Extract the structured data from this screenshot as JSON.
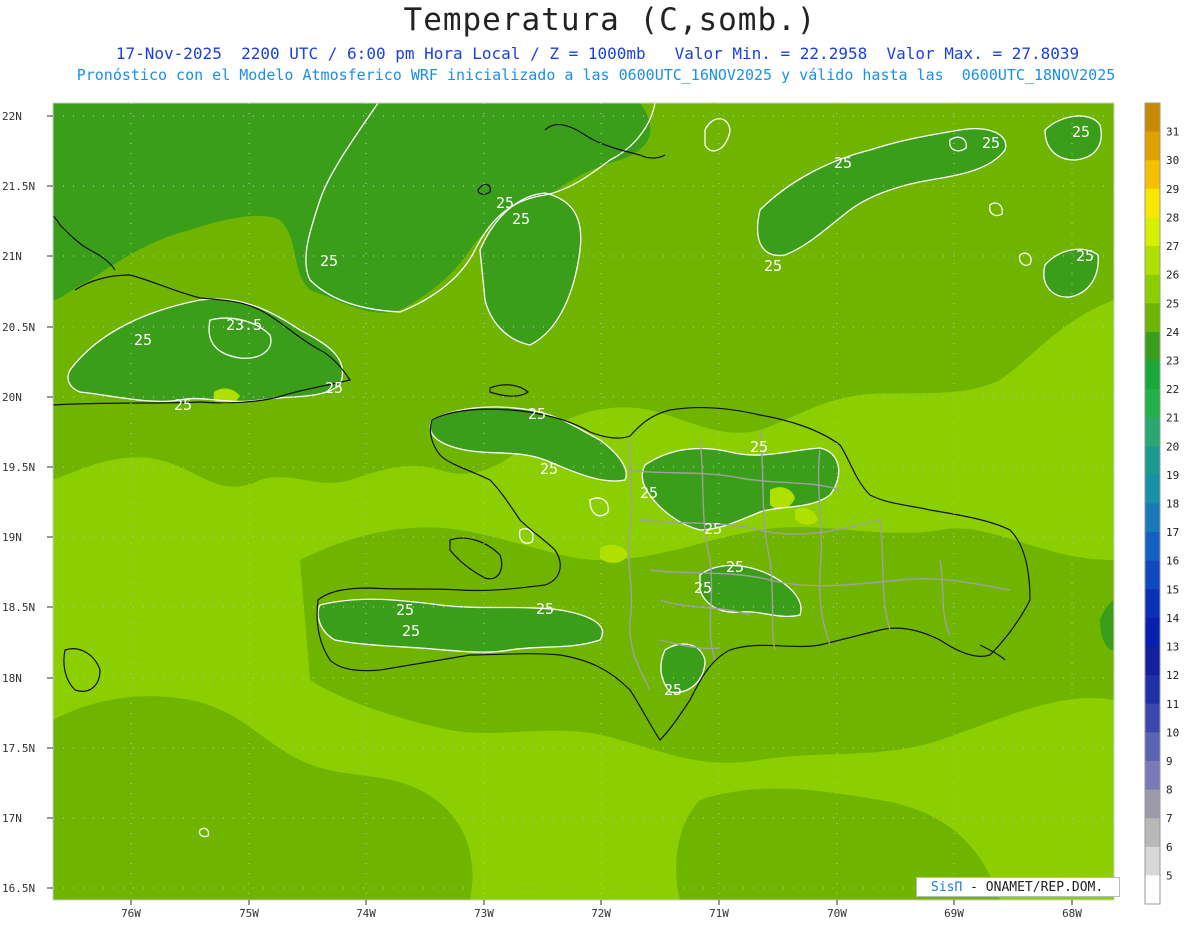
{
  "header": {
    "title": "Temperatura (C,somb.)",
    "subtitle_line1": "17-Nov-2025  2200 UTC / 6:00 pm Hora Local / Z = 1000mb   Valor Min. = 22.2958  Valor Max. = 27.8039",
    "subtitle_line2": "Pronóstico con el Modelo Atmosferico WRF inicializado a las 0600UTC_16NOV2025 y válido hasta las  0600UTC_18NOV2025"
  },
  "axes": {
    "lat_labels": [
      "22N",
      "21.5N",
      "21N",
      "20.5N",
      "20N",
      "19.5N",
      "19N",
      "18.5N",
      "18N",
      "17.5N",
      "17N",
      "16.5N"
    ],
    "lon_labels": [
      "76W",
      "75W",
      "74W",
      "73W",
      "72W",
      "71W",
      "70W",
      "69W",
      "68W"
    ]
  },
  "contour_labels": [
    "25",
    "25",
    "25",
    "25",
    "23.5",
    "25",
    "25",
    "25",
    "25",
    "25",
    "25",
    "25",
    "25",
    "25",
    "25",
    "25",
    "25",
    "25",
    "25",
    "25",
    "25",
    "25",
    "25"
  ],
  "colorbar": {
    "labels": [
      "31",
      "30",
      "29",
      "28",
      "27",
      "26",
      "25",
      "24",
      "23",
      "22",
      "21",
      "20",
      "19",
      "18",
      "17",
      "16",
      "15",
      "14",
      "13",
      "12",
      "11",
      "10",
      "9",
      "8",
      "7",
      "6",
      "5"
    ],
    "colors": [
      "#c88a00",
      "#e0a000",
      "#f5c000",
      "#f8e800",
      "#d8f000",
      "#b0e000",
      "#8ccf00",
      "#6fb500",
      "#3a9e1a",
      "#1aa83a",
      "#22b04a",
      "#2aa870",
      "#1a9a90",
      "#1890a8",
      "#1878b8",
      "#1460c0",
      "#1048c0",
      "#0a30b8",
      "#0820b0",
      "#1420a0",
      "#2030a8",
      "#3c48b0",
      "#5a64b4",
      "#7a7ab8",
      "#9a9aa8",
      "#b8b8b8",
      "#d8d8d8",
      "#ffffff"
    ]
  },
  "credit": {
    "brand": "SisΠ",
    "text": " - ONAMET/REP.DOM."
  }
}
